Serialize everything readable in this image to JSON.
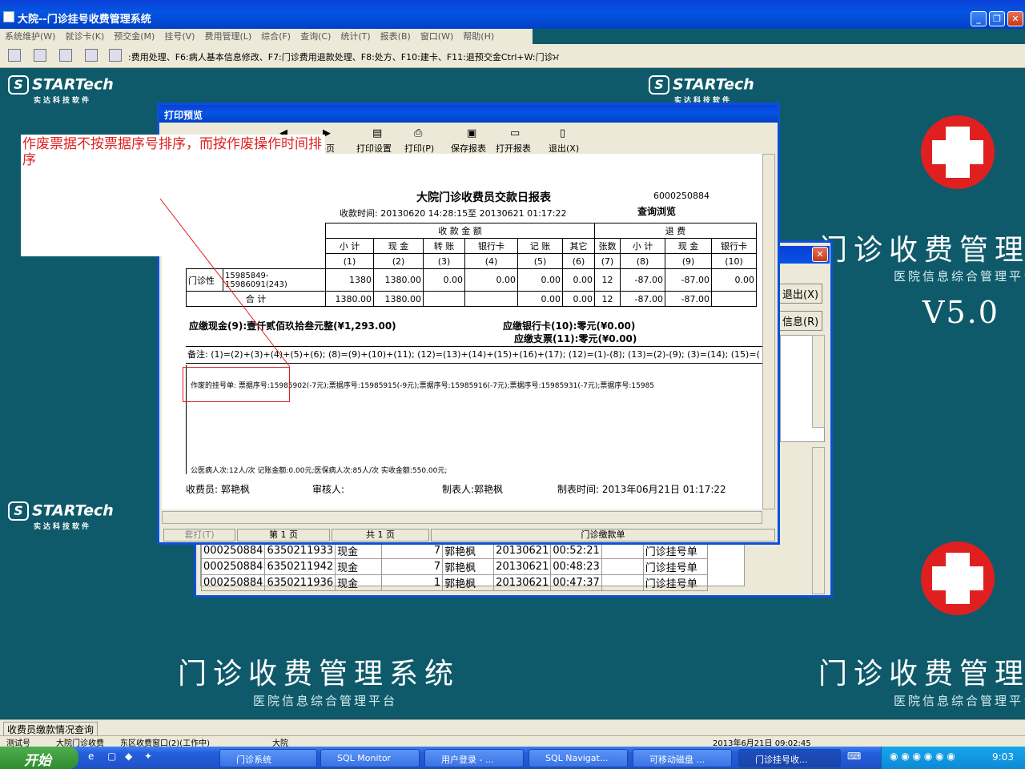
{
  "window": {
    "title": "大院--门诊挂号收费管理系统"
  },
  "menu": [
    "系统维护(W)",
    "就诊卡(K)",
    "预交金(M)",
    "挂号(V)",
    "费用管理(L)",
    "综合(F)",
    "查询(C)",
    "统计(T)",
    "报表(B)",
    "窗口(W)",
    "帮助(H)"
  ],
  "toolbar": {
    "hint": ":费用处理、F6:病人基本信息修改、F7:门诊费用退款处理、F8:处方、F10:建卡、F11:退预交金Ctrl+W:门诊ਮ"
  },
  "desktop": {
    "logo_text": "STARTech",
    "logo_sub": "实达科技软件",
    "big_title": "门诊收费管理系统",
    "big_title_right": "门诊收费管理理",
    "platform": "医院信息综合管理平台",
    "platform_right": "医院信息综合管理平台",
    "version": "V5.0"
  },
  "bgwindow": {
    "exit_label": "退出(X)",
    "info_label": "信息(R)",
    "rows": [
      [
        "000250884",
        "6350211933",
        "现金",
        "7",
        "郭艳枫",
        "20130621",
        "00:52:21",
        "门诊挂号单"
      ],
      [
        "000250884",
        "6350211942",
        "现金",
        "7",
        "郭艳枫",
        "20130621",
        "00:48:23",
        "门诊挂号单"
      ],
      [
        "000250884",
        "6350211936",
        "现金",
        "1",
        "郭艳枫",
        "20130621",
        "00:47:37",
        "门诊挂号单"
      ]
    ]
  },
  "preview": {
    "title": "打印预览",
    "tools": {
      "page": "-页",
      "print_setup": "打印设置",
      "print": "打印(P)",
      "save": "保存报表",
      "open": "打开报表",
      "exit": "退出(X)"
    },
    "status": {
      "check": "套打(T)",
      "page": "第 1 页",
      "total": "共 1 页",
      "name": "门诊缴款单"
    }
  },
  "report": {
    "title": "大院门诊收费员交款日报表",
    "code": "6000250884",
    "period": "收款时间: 20130620 14:28:15至 20130621 01:17:22",
    "mode": "查询浏览",
    "group_income": "收 款 金 额",
    "group_refund": "退 费",
    "headers": [
      "小 计",
      "现 金",
      "转 账",
      "银行卡",
      "记 账",
      "其它",
      "张数",
      "小 计",
      "现 金",
      "银行卡"
    ],
    "col_nums": [
      "(1)",
      "(2)",
      "(3)",
      "(4)",
      "(5)",
      "(6)",
      "(7)",
      "(8)",
      "(9)",
      "(10)"
    ],
    "row_label": "门诊性",
    "row_range": "15985849-15986091(243)",
    "row_values": [
      "1380",
      "1380.00",
      "0.00",
      "0.00",
      "0.00",
      "0.00",
      "12",
      "-87.00",
      "-87.00",
      "0.00"
    ],
    "total_label": "合 计",
    "total_values": [
      "1380.00",
      "1380.00",
      "",
      "",
      "0.00",
      "0.00",
      "12",
      "-87.00",
      "-87.00",
      ""
    ],
    "cash_due": "应缴现金(9):壹仟贰佰玖拾叁元整(¥1,293.00)",
    "card_due": "应缴银行卡(10):零元(¥0.00)",
    "cheque_due": "应缴支票(11):零元(¥0.00)",
    "remark": "备注: (1)=(2)+(3)+(4)+(5)+(6); (8)=(9)+(10)+(11); (12)=(13)+(14)+(15)+(16)+(17); (12)=(1)-(8); (13)=(2)-(9); (3)=(14); (15)=(",
    "voided": "作废的挂号单: 票据序号:15985902(-7元);票据序号:15985915(-9元);票据序号:15985916(-7元);票据序号:15985931(-7元);票据序号:15985",
    "summary": "公医病人次:12人/次 记账金额:0.00元;医保病人次:85人/次 实收金额:550.00元;",
    "cashier": "收费员: 郭艳枫",
    "auditor": "审核人:",
    "maker": "制表人:郭艳枫",
    "made_time": "制表时间: 2013年06月21日 01:17:22"
  },
  "annotation": {
    "text": "作废票据不按票据序号排序，而按作废操作时间排序"
  },
  "statusbar": {
    "query": "收费员缴款情况查询",
    "line2": [
      "测试号",
      "大院门诊收费",
      "东区收费窗口(2)(工作中)",
      "大院",
      "2013年6月21日 09:02:45"
    ]
  },
  "taskbar": {
    "start": "开始",
    "tasks": [
      "门诊系统",
      "SQL Monitor",
      "用户登录 - ...",
      "SQL Navigat...",
      "可移动磁盘 ...",
      "门诊挂号收..."
    ],
    "clock": "9:03"
  },
  "colors": {
    "desktop": "#0f5a6a",
    "title": "#0554e3",
    "annotation": "#e02020"
  }
}
